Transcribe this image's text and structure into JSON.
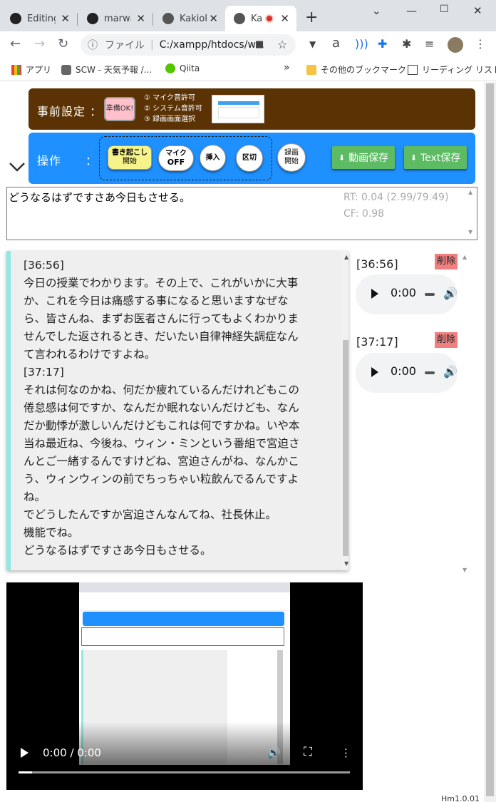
{
  "tabs": [
    {
      "title": "Editing",
      "icon": "github-icon"
    },
    {
      "title": "marwa",
      "icon": "github-icon"
    },
    {
      "title": "Kakiok",
      "icon": "globe-icon"
    },
    {
      "title": "Ka",
      "icon": "globe-icon",
      "recording": true
    }
  ],
  "toolbar": {
    "url_label": "ファイル",
    "url": "C:/xampp/htdocs/w..."
  },
  "bookmarks": [
    {
      "label": "アプリ"
    },
    {
      "label": "SCW - 天気予報 /..."
    },
    {
      "label": "Qiita"
    },
    {
      "label": "»"
    },
    {
      "label": "その他のブックマーク"
    },
    {
      "label": "リーディング リスト"
    }
  ],
  "setup": {
    "title": "事前設定 ：",
    "ready_button": "準備OK!",
    "steps": [
      "① マイク音許可",
      "② システム音許可",
      "③ 録画画面選択"
    ]
  },
  "ops": {
    "title": "操作　　：",
    "transcribe_line1": "書き起こし",
    "transcribe_line2": "開始",
    "mic_line1": "マイク",
    "mic_line2": "OFF",
    "insert": "挿入",
    "separator": "区切",
    "record_line1": "録画",
    "record_line2": "開始",
    "video_save": "動画保存",
    "text_save": "Text保存"
  },
  "live": {
    "text": "どうなるはずですさあ今日もさせる。",
    "rt": "RT: 0.04 (2.99/79.49)",
    "cf": "CF: 0.98"
  },
  "transcript": {
    "lines": [
      "[36:56]",
      "今日の授業でわかります。その上で、これがいかに大事",
      "か、これを今日は痛感する事になると思いますなぜな",
      "ら、皆さんね、まずお医者さんに行ってもよくわかりま",
      "せんでした返されるとき、だいたい自律神経失調症なん",
      "て言われるわけですよね。",
      "[37:17]",
      "それは何なのかね、何だか疲れているんだけれどもこの",
      "倦怠感は何ですか、なんだか眠れないんだけども、なん",
      "だか動悸が激しいんだけどもこれは何ですかね。いや本",
      "当ね最近ね、今後ね、ウィン・ミンという番組で宮迫さ",
      "んとご一緒するんですけどね、宮迫さんがね、なんかこ",
      "う、ウィンウィンの前でちっちゃい粒飲んでるんですよ",
      "ね。",
      "でどうしたんですか宮迫さんなんてね、社長休止。",
      "機能でね。",
      "どうなるはずですさあ今日もさせる。"
    ]
  },
  "clips": [
    {
      "timestamp": "[36:56]",
      "delete": "削除",
      "time": "0:00"
    },
    {
      "timestamp": "[37:17]",
      "delete": "削除",
      "time": "0:00"
    }
  ],
  "video": {
    "time": "0:00 / 0:00",
    "progress": 0.04
  },
  "version": "Hm1.0.01",
  "colors": {
    "setup_bg": "#5a3204",
    "ops_bg": "#1e90ff",
    "save_btn": "#5dbb63",
    "delete_btn": "#f08080",
    "transcript_accent": "#8fe9e4"
  }
}
